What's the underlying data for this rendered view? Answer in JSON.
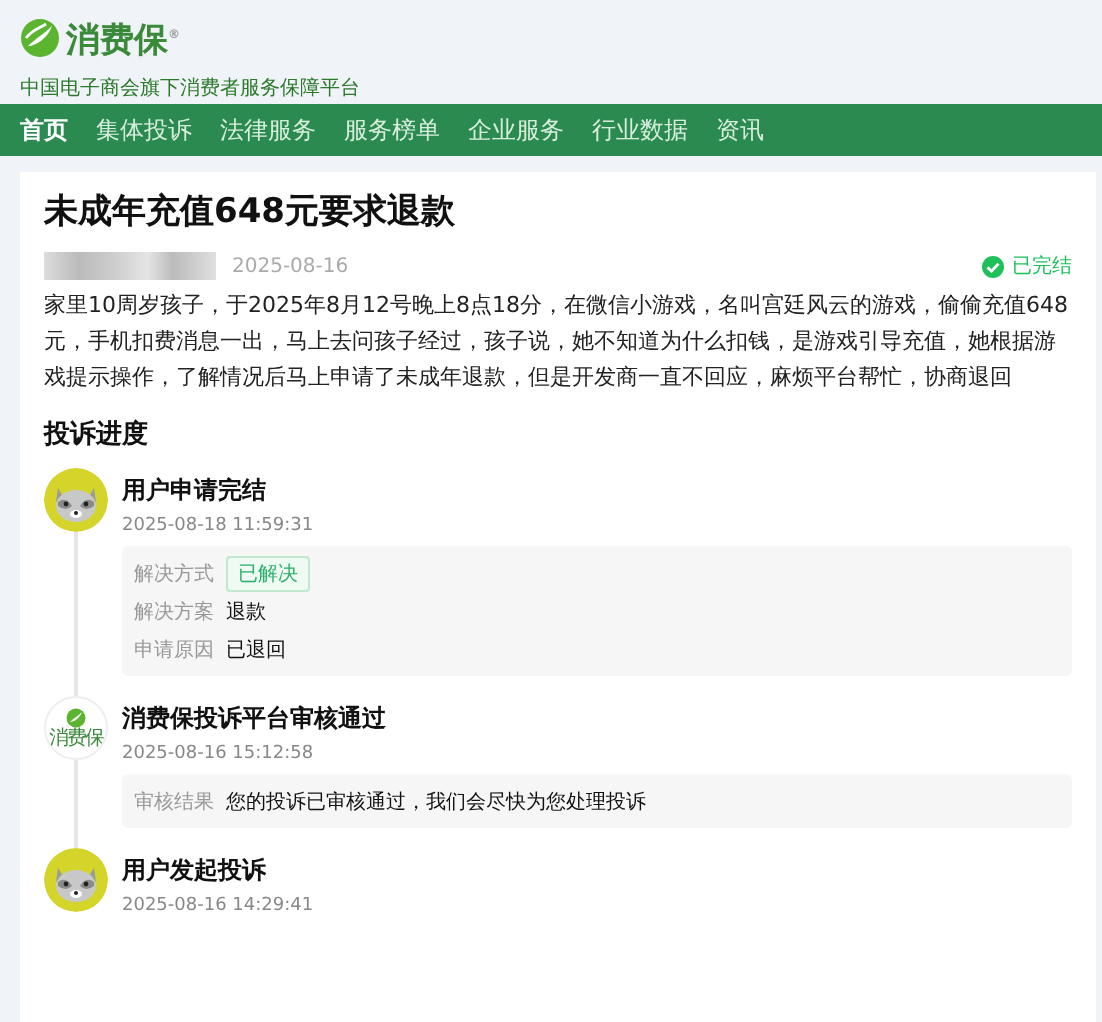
{
  "header": {
    "logo_text": "消费保$^{®}$",
    "tagline": "中国电子商会旗下消费者服务保障平台"
  },
  "nav": [
    {
      "label": "首页",
      "selected": true
    },
    {
      "label": "集体投诉",
      "selected": false
    },
    {
      "label": "法律服务",
      "selected": false
    },
    {
      "label": "服务榜单",
      "selected": false
    },
    {
      "label": "企业服务",
      "selected": false
    },
    {
      "label": "行业数据",
      "selected": false
    },
    {
      "label": "资讯",
      "selected": false
    }
  ],
  "complaint": {
    "title": "未成年充值648元要求退款",
    "date": "2025-08-16",
    "status": "已完结",
    "completed": true,
    "body": "家里10周岁孩子，于2025年8月12号晚上8点18分，在微信小游戏，名叫宫廷风云的游戏，偷偷充值648元，手机扣费消息一出，马上去问孩子经过，孩子说，她不知道为什么扣钱，是游戏引导充值，她根据游戏提示操作，了解情况后马上申请了未成年退款，但是开发商一直不回应，麻烦平台帮忙，协商退回"
  },
  "progress": {
    "heading": "投诉进度",
    "events": [
      {
        "kind": "user",
        "title": "用户申请完结",
        "time": "2025-08-18 11:59:31",
        "details": [
          {
            "kind": "tag",
            "label": "解决方式",
            "value": "已解决"
          },
          {
            "kind": "text",
            "label": "解决方案",
            "value": "退款"
          },
          {
            "kind": "text",
            "label": "申请原因",
            "value": "已退回"
          }
        ]
      },
      {
        "kind": "platform",
        "avatar_text": "消费保",
        "title": "消费保投诉平台审核通过",
        "time": "2025-08-16 15:12:58",
        "details": [
          {
            "kind": "text",
            "label": "审核结果",
            "value": "您的投诉已审核通过，我们会尽快为您处理投诉"
          }
        ]
      },
      {
        "kind": "user",
        "title": "用户发起投诉",
        "time": "2025-08-16 14:29:41"
      }
    ]
  }
}
